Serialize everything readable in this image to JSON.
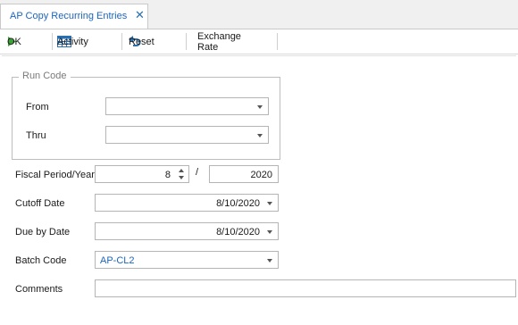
{
  "tab": {
    "title": "AP Copy Recurring Entries",
    "close_glyph": "✕"
  },
  "toolbar": {
    "ok_label": "OK",
    "activity_label": "Activity",
    "reset_label": "Reset",
    "exchange_rate_label": "Exchange Rate"
  },
  "run_code": {
    "legend": "Run Code",
    "from_label": "From",
    "from_value": "",
    "thru_label": "Thru",
    "thru_value": ""
  },
  "fiscal": {
    "label": "Fiscal Period/Year",
    "period": "8",
    "separator": "/",
    "year": "2020"
  },
  "cutoff_date": {
    "label": "Cutoff Date",
    "value": "8/10/2020"
  },
  "due_by_date": {
    "label": "Due by Date",
    "value": "8/10/2020"
  },
  "batch_code": {
    "label": "Batch Code",
    "value": "AP-CL2"
  },
  "comments": {
    "label": "Comments",
    "value": ""
  },
  "colors": {
    "accent": "#1a66c2",
    "ok_green": "#3aa335",
    "border": "#b5b5b5"
  }
}
